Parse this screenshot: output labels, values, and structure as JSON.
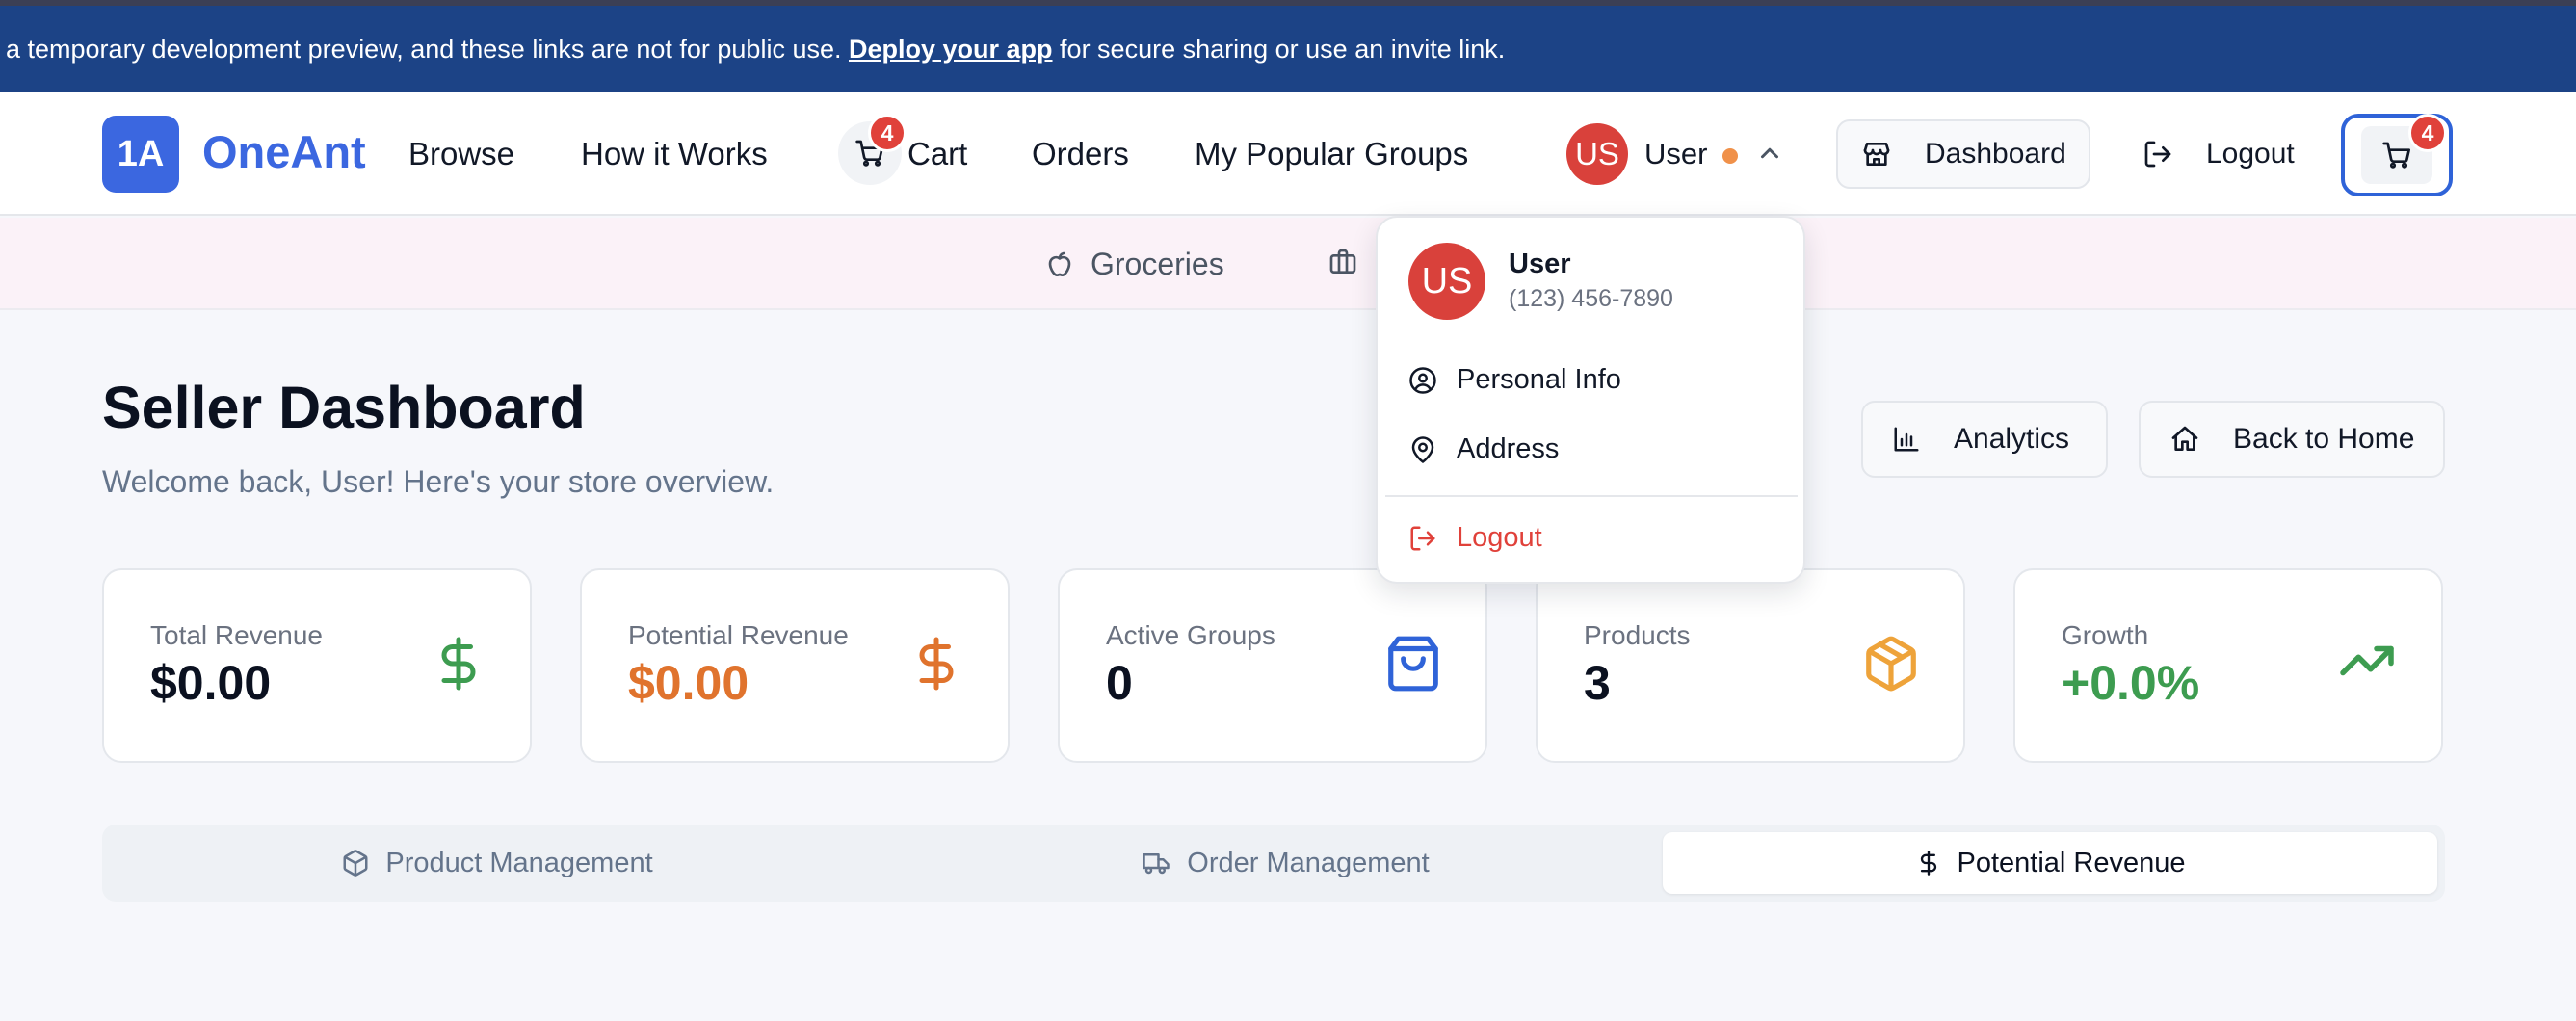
{
  "banner": {
    "text_before": "a temporary development preview, and these links are not for public use.",
    "link_text": "Deploy your app",
    "text_after": "for secure sharing or use an invite link."
  },
  "nav": {
    "logo_mark": "1A",
    "logo_text": "OneAnt",
    "links": [
      "Browse",
      "How it Works",
      "Cart",
      "Orders",
      "My Popular Groups"
    ],
    "cart_count": "4",
    "user_initials": "US",
    "user_name": "User",
    "dashboard_label": "Dashboard",
    "logout_label": "Logout",
    "cart_button_count": "4"
  },
  "categories": [
    "Groceries"
  ],
  "page": {
    "title": "Seller Dashboard",
    "subtitle": "Welcome back, User! Here's your store overview.",
    "analytics_label": "Analytics",
    "home_label": "Back to Home"
  },
  "stats": [
    {
      "label": "Total Revenue",
      "value": "$0.00",
      "icon": "dollar-icon",
      "color": "#3d9c50"
    },
    {
      "label": "Potential Revenue",
      "value": "$0.00",
      "icon": "dollar-icon",
      "color": "#e0732d"
    },
    {
      "label": "Active Groups",
      "value": "0",
      "icon": "shopping-bag-icon",
      "color": "#2f63d8"
    },
    {
      "label": "Products",
      "value": "3",
      "icon": "package-icon",
      "color": "#eea33a"
    },
    {
      "label": "Growth",
      "value": "+0.0%",
      "icon": "trending-up-icon",
      "color": "#3d9c50"
    }
  ],
  "tabs": [
    {
      "label": "Product Management",
      "icon": "package-icon",
      "active": false
    },
    {
      "label": "Order Management",
      "icon": "truck-icon",
      "active": false
    },
    {
      "label": "Potential Revenue",
      "icon": "dollar-icon",
      "active": true
    }
  ],
  "dropdown": {
    "initials": "US",
    "name": "User",
    "phone": "(123) 456-7890",
    "personal_info": "Personal Info",
    "address": "Address",
    "logout": "Logout"
  },
  "colors": {
    "banner": "#1c4386",
    "brand": "#3b67e0",
    "danger": "#e0413a"
  }
}
